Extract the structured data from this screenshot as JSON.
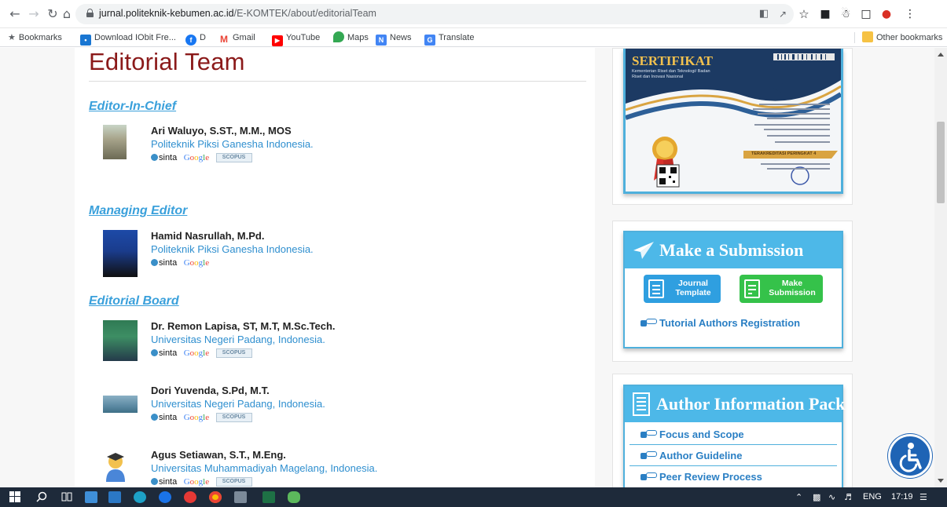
{
  "browser": {
    "url_host": "jurnal.politeknik-kebumen.ac.id",
    "url_path": "/E-KOMTEK/about/editorialTeam",
    "bookmarks": [
      {
        "label": "Bookmarks",
        "icon": "star-icon",
        "color": "#5f6368"
      },
      {
        "label": "Download IObit Fre...",
        "icon": "iobit-icon",
        "color": "#1976d2"
      },
      {
        "label": "D",
        "icon": "facebook-icon",
        "color": "#1877f2"
      },
      {
        "label": "Gmail",
        "icon": "gmail-icon",
        "color": "#ea4335"
      },
      {
        "label": "YouTube",
        "icon": "youtube-icon",
        "color": "#ff0000"
      },
      {
        "label": "Maps",
        "icon": "maps-icon",
        "color": "#34a853"
      },
      {
        "label": "News",
        "icon": "news-icon",
        "color": "#4285f4"
      },
      {
        "label": "Translate",
        "icon": "translate-icon",
        "color": "#4285f4"
      }
    ],
    "other_bookmarks": "Other bookmarks"
  },
  "page": {
    "title": "Editorial Team",
    "sections": {
      "chief": "Editor-In-Chief",
      "managing": "Managing Editor",
      "board": "Editorial Board"
    },
    "people": [
      {
        "name": "Ari Waluyo, S.ST., M.M., MOS",
        "affiliation": "Politeknik Piksi Ganesha Indonesia.",
        "scopus": true
      },
      {
        "name": "Hamid Nasrullah, M.Pd.",
        "affiliation": "Politeknik Piksi Ganesha Indonesia.",
        "scopus": false
      },
      {
        "name": "Dr. Remon Lapisa, ST, M.T, M.Sc.Tech.",
        "affiliation": "Universitas Negeri Padang, Indonesia.",
        "scopus": true
      },
      {
        "name": "Dori Yuvenda, S.Pd, M.T.",
        "affiliation": "Universitas Negeri Padang, Indonesia.",
        "scopus": true
      },
      {
        "name": "Agus Setiawan, S.T., M.Eng.",
        "affiliation": "Universitas Muhammadiyah Magelang, Indonesia.",
        "scopus": true
      }
    ],
    "badges": {
      "sinta": "sinta",
      "google": "Google",
      "scopus": "SCOPUS"
    }
  },
  "sidebar": {
    "certificate": {
      "title": "SERTIFIKAT",
      "subtitle": "Kementerian Riset dan Teknologi/ Badan Riset dan Inovasi Nasional",
      "rank": "TERAKREDITASI PERINGKAT 4"
    },
    "submission": {
      "heading": "Make a Submission",
      "template_btn": "Journal Template",
      "submit_btn": "Make Submission",
      "tutorial_link": "Tutorial Authors Registration"
    },
    "info_pack": {
      "heading": "Author Information Pack",
      "links": [
        "Focus and Scope",
        "Author Guideline",
        "Peer Review Process"
      ]
    }
  },
  "taskbar": {
    "lang": "ENG",
    "time": "17:19"
  },
  "colors": {
    "title": "#8b1a1a",
    "section": "#3aa0db",
    "affiliation": "#2f8fcf",
    "sidebar_head": "#4db8e8",
    "template_btn": "#2f9fe0",
    "submit_btn": "#35c24a"
  }
}
